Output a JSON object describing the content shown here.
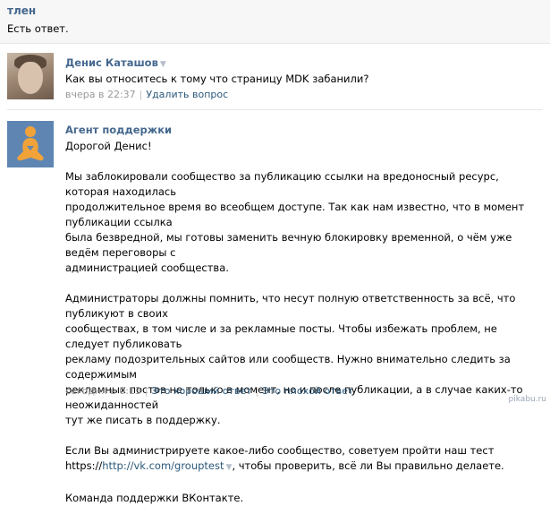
{
  "topic": {
    "title": "тлен",
    "subtitle": "Есть ответ."
  },
  "question": {
    "author": "Денис Каташов",
    "text": "Как вы относитесь к тому что страницу MDK забанили?",
    "time": "вчера в 22:37",
    "delete_label": "Удалить вопрос"
  },
  "answer": {
    "author": "Агент поддержки",
    "greeting": "Дорогой Денис!",
    "paragraph1": [
      "Мы заблокировали сообщество за публикацию ссылки на вредоносный ресурс, которая находилась",
      "продолжительное время во всеобщем доступе. Так как нам известно, что в момент публикации ссылка",
      "была безвредной, мы готовы заменить вечную блокировку временной, о чём уже ведём переговоры с",
      "администрацией сообщества."
    ],
    "paragraph2": [
      "Администраторы должны помнить, что несут полную ответственность за всё, что публикуют в своих",
      "сообществах, в том числе и за рекламные посты. Чтобы избежать проблем, не следует публиковать",
      "рекламу подозрительных сайтов или сообществ. Нужно внимательно следить за содержимым",
      "рекламных постов не только в момент, но и после публикации, а в случае каких-то неожиданностей",
      "тут же писать в поддержку."
    ],
    "paragraph3_line1": "Если Вы администрируете какое-либо сообщество, советуем пройти наш тест",
    "paragraph3_prefix": "https://",
    "paragraph3_link": "http://vk.com/grouptest",
    "paragraph3_suffix": ", чтобы проверить, всё ли Вы правильно делаете.",
    "signature": "Команда поддержки ВКонтакте.",
    "time": "сегодня в 0:13",
    "good_label": "Это хороший ответ",
    "bad_label": "Это плохой ответ"
  },
  "watermark": "pikabu.ru",
  "icons": {
    "user_avatar": "user-photo",
    "agent_avatar": "meditating-figure-icon",
    "dropdown": "caret-down-icon"
  },
  "colors": {
    "link": "#2b587a",
    "author": "#45688e",
    "meta": "#999999",
    "agent_bg": "#5f86b3",
    "agent_figure": "#f1a33a"
  }
}
